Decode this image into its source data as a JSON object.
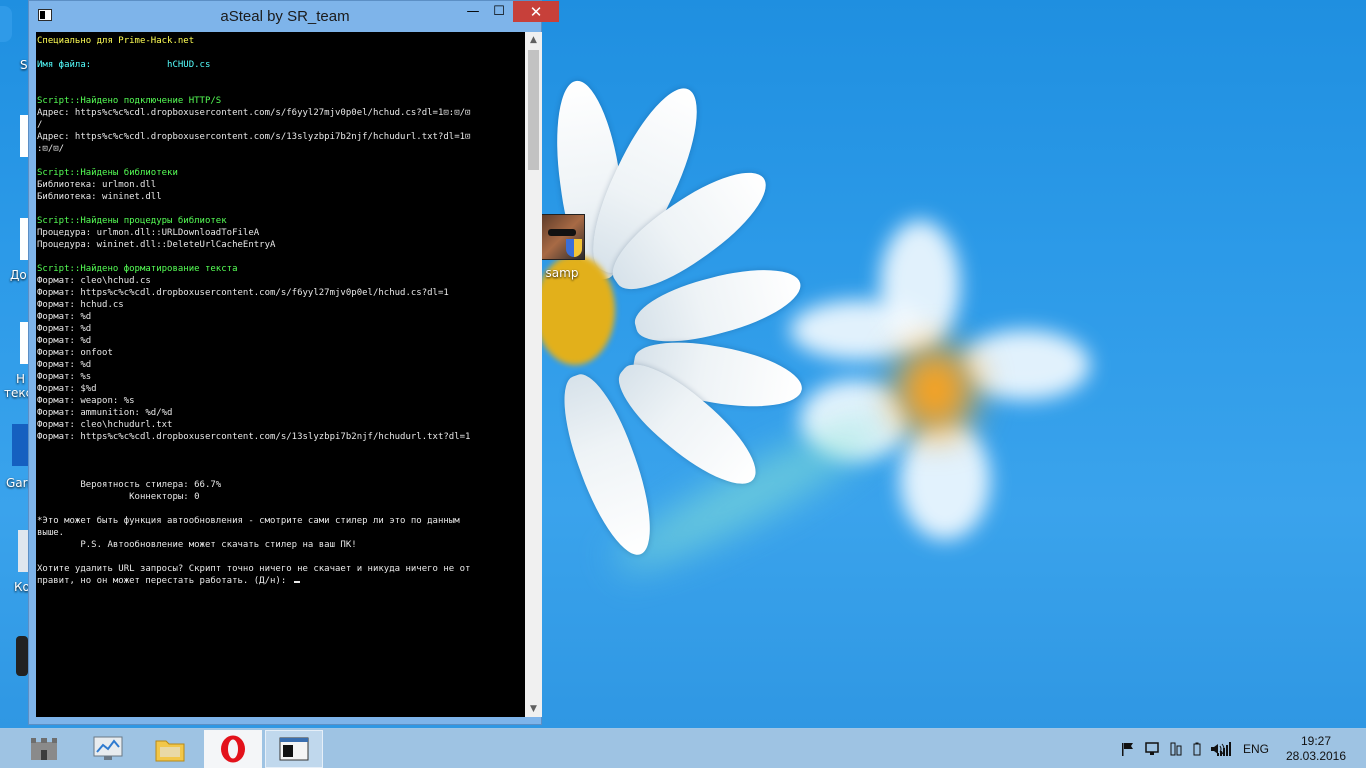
{
  "window": {
    "title": "aSteal by SR_team",
    "min_glyph": "—",
    "max_glyph": "☐",
    "close_glyph": "✕"
  },
  "console": {
    "lines": [
      {
        "text": "Специально для Prime-Hack.net",
        "color": "yellow"
      },
      {
        "text": "",
        "color": "white"
      },
      {
        "text": "Имя файла:              hCHUD.cs",
        "color": "cyan"
      },
      {
        "text": "",
        "color": "white"
      },
      {
        "text": "",
        "color": "white"
      },
      {
        "text": "Script::Найдено подключение HTTP/S",
        "color": "green"
      },
      {
        "text": "Адрес: https%c%c%cdl.dropboxusercontent.com/s/f6yyl27mjv0p0el/hchud.cs?dl=1⊡:⊡/⊡",
        "color": "white"
      },
      {
        "text": "/",
        "color": "white"
      },
      {
        "text": "Адрес: https%c%c%cdl.dropboxusercontent.com/s/13slyzbpi7b2njf/hchudurl.txt?dl=1⊡",
        "color": "white"
      },
      {
        "text": ":⊡/⊡/",
        "color": "white"
      },
      {
        "text": "",
        "color": "white"
      },
      {
        "text": "Script::Найдены библиотеки",
        "color": "green"
      },
      {
        "text": "Библиотека: urlmon.dll",
        "color": "white"
      },
      {
        "text": "Библиотека: wininet.dll",
        "color": "white"
      },
      {
        "text": "",
        "color": "white"
      },
      {
        "text": "Script::Найдены процедуры библиотек",
        "color": "green"
      },
      {
        "text": "Процедура: urlmon.dll::URLDownloadToFileA",
        "color": "white"
      },
      {
        "text": "Процедура: wininet.dll::DeleteUrlCacheEntryA",
        "color": "white"
      },
      {
        "text": "",
        "color": "white"
      },
      {
        "text": "Script::Найдено форматирование текста",
        "color": "green"
      },
      {
        "text": "Формат: cleo\\hchud.cs",
        "color": "white"
      },
      {
        "text": "Формат: https%c%c%cdl.dropboxusercontent.com/s/f6yyl27mjv0p0el/hchud.cs?dl=1",
        "color": "white"
      },
      {
        "text": "Формат: hchud.cs",
        "color": "white"
      },
      {
        "text": "Формат: %d",
        "color": "white"
      },
      {
        "text": "Формат: %d",
        "color": "white"
      },
      {
        "text": "Формат: %d",
        "color": "white"
      },
      {
        "text": "Формат: onfoot",
        "color": "white"
      },
      {
        "text": "Формат: %d",
        "color": "white"
      },
      {
        "text": "Формат: %s",
        "color": "white"
      },
      {
        "text": "Формат: $%d",
        "color": "white"
      },
      {
        "text": "Формат: weapon: %s",
        "color": "white"
      },
      {
        "text": "Формат: ammunition: %d/%d",
        "color": "white"
      },
      {
        "text": "Формат: cleo\\hchudurl.txt",
        "color": "white"
      },
      {
        "text": "Формат: https%c%c%cdl.dropboxusercontent.com/s/13slyzbpi7b2njf/hchudurl.txt?dl=1",
        "color": "white"
      },
      {
        "text": "",
        "color": "white"
      },
      {
        "text": "",
        "color": "white"
      },
      {
        "text": "",
        "color": "white"
      },
      {
        "text": "        Вероятность стилера: 66.7%",
        "color": "white"
      },
      {
        "text": "                 Коннекторы: 0",
        "color": "white"
      },
      {
        "text": "",
        "color": "white"
      },
      {
        "text": "*Это может быть функция автообновления - смотрите сами стилер ли это по данным",
        "color": "white"
      },
      {
        "text": "выше.",
        "color": "white"
      },
      {
        "text": "        P.S. Автообновление может скачать стилер на ваш ПК!",
        "color": "white"
      },
      {
        "text": "",
        "color": "white"
      },
      {
        "text": "Хотите удалить URL запросы? Скрипт точно ничего не скачает и никуда ничего не от",
        "color": "white"
      },
      {
        "text": "правит, но он может перестать работать. (Д/н): ",
        "color": "white",
        "cursor": true
      }
    ]
  },
  "desktop": {
    "samp_icon_label": "samp",
    "left_icon_fragments": [
      "S",
      "До",
      "Н",
      "текс",
      "Garr",
      "Ко"
    ]
  },
  "taskbar": {
    "apps": [
      {
        "name": "taskbar-app-castle",
        "icon": "castle-icon",
        "active": false
      },
      {
        "name": "taskbar-app-monitor",
        "icon": "monitor-icon",
        "active": false
      },
      {
        "name": "taskbar-app-explorer",
        "icon": "folder-icon",
        "active": false
      },
      {
        "name": "taskbar-app-opera",
        "icon": "opera-icon",
        "active": false
      },
      {
        "name": "taskbar-app-console",
        "icon": "console-icon",
        "active": true
      }
    ],
    "language": "ENG",
    "time": "19:27",
    "date": "28.03.2016"
  },
  "colors": {
    "desktop_bg": "#2c9ae8",
    "title_bg": "#7eb4ea",
    "close_btn": "#c7403a",
    "console_yellow": "#ffff55",
    "console_cyan": "#55ffff",
    "console_green": "#55ff55",
    "console_white": "#e8e8e8"
  }
}
